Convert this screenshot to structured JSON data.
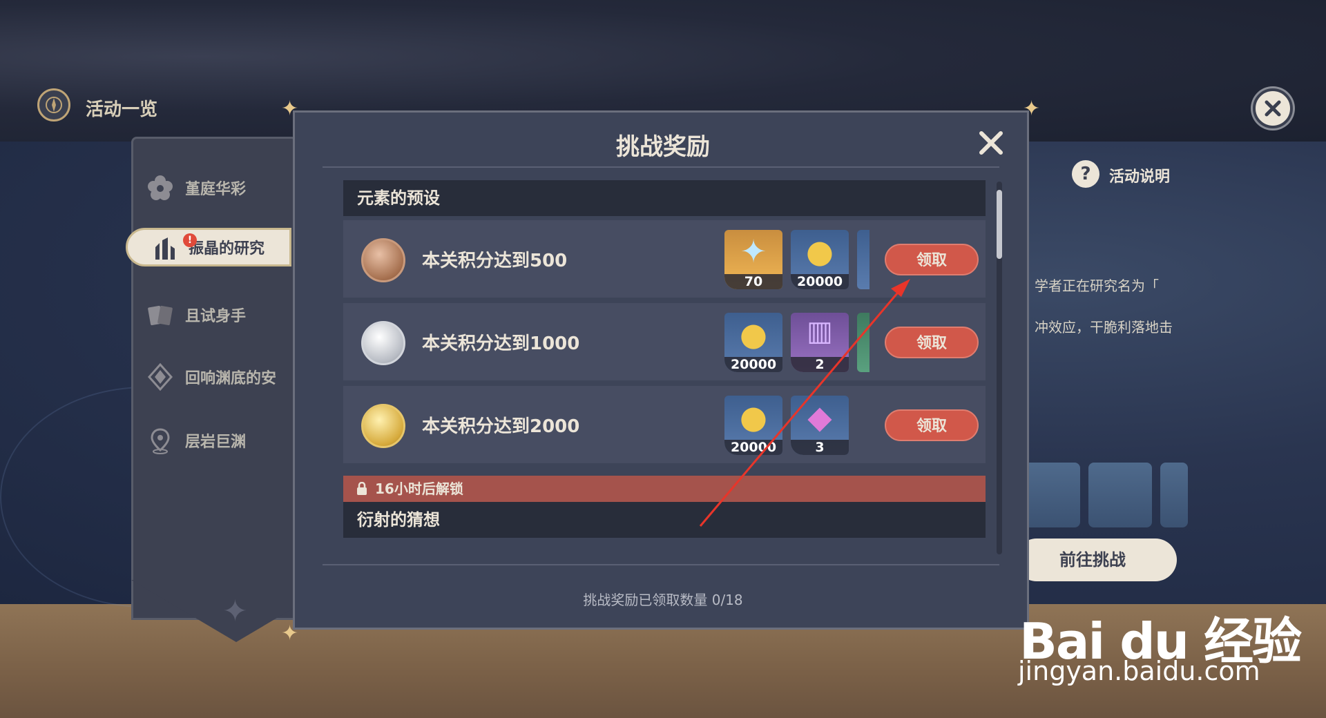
{
  "header": {
    "title": "活动一览"
  },
  "sidebar": {
    "items": [
      {
        "label": "堇庭华彩",
        "icon": "flower-icon",
        "active": false
      },
      {
        "label": "振晶的研究",
        "icon": "research-figure-icon",
        "active": true,
        "badge": "!"
      },
      {
        "label": "且试身手",
        "icon": "cards-icon",
        "active": false
      },
      {
        "label": "回响渊底的安",
        "icon": "diamond-icon",
        "active": false
      },
      {
        "label": "层岩巨渊",
        "icon": "map-pin-icon",
        "active": false
      }
    ]
  },
  "background": {
    "help_label": "活动说明",
    "help_icon": "?",
    "text_lines": [
      "学者正在研究名为「",
      "冲效应，干脆利落地击"
    ],
    "go_button": "前往挑战"
  },
  "modal": {
    "title": "挑战奖励",
    "sections": [
      {
        "header": "元素的预设",
        "rows": [
          {
            "label": "本关积分达到500",
            "medal": "bronze",
            "rewards": [
              {
                "icon": "primogem-icon",
                "count": "70",
                "rarity": "gold"
              },
              {
                "icon": "mora-coin-icon",
                "count": "20000",
                "rarity": "blue"
              }
            ],
            "button": "领取"
          },
          {
            "label": "本关积分达到1000",
            "medal": "silver",
            "rewards": [
              {
                "icon": "mora-coin-icon",
                "count": "20000",
                "rarity": "blue"
              },
              {
                "icon": "book-icon",
                "count": "2",
                "rarity": "purple"
              }
            ],
            "button": "领取"
          },
          {
            "label": "本关积分达到2000",
            "medal": "gold",
            "rewards": [
              {
                "icon": "mora-coin-icon",
                "count": "20000",
                "rarity": "blue"
              },
              {
                "icon": "crystal-icon",
                "count": "3",
                "rarity": "blue"
              }
            ],
            "button": "领取"
          }
        ]
      },
      {
        "header": "衍射的猜想",
        "lock_text": "16小时后解锁"
      }
    ],
    "footer": "挑战奖励已领取数量 0/18"
  },
  "watermark": {
    "logo": "Bai du 经验",
    "url": "jingyan.baidu.com"
  },
  "colors": {
    "accent_red": "#d1584a",
    "lock_bar": "#a5534c",
    "text_light": "#ece5d8",
    "panel": "#3d4458",
    "annotation_arrow": "#e8352a"
  }
}
